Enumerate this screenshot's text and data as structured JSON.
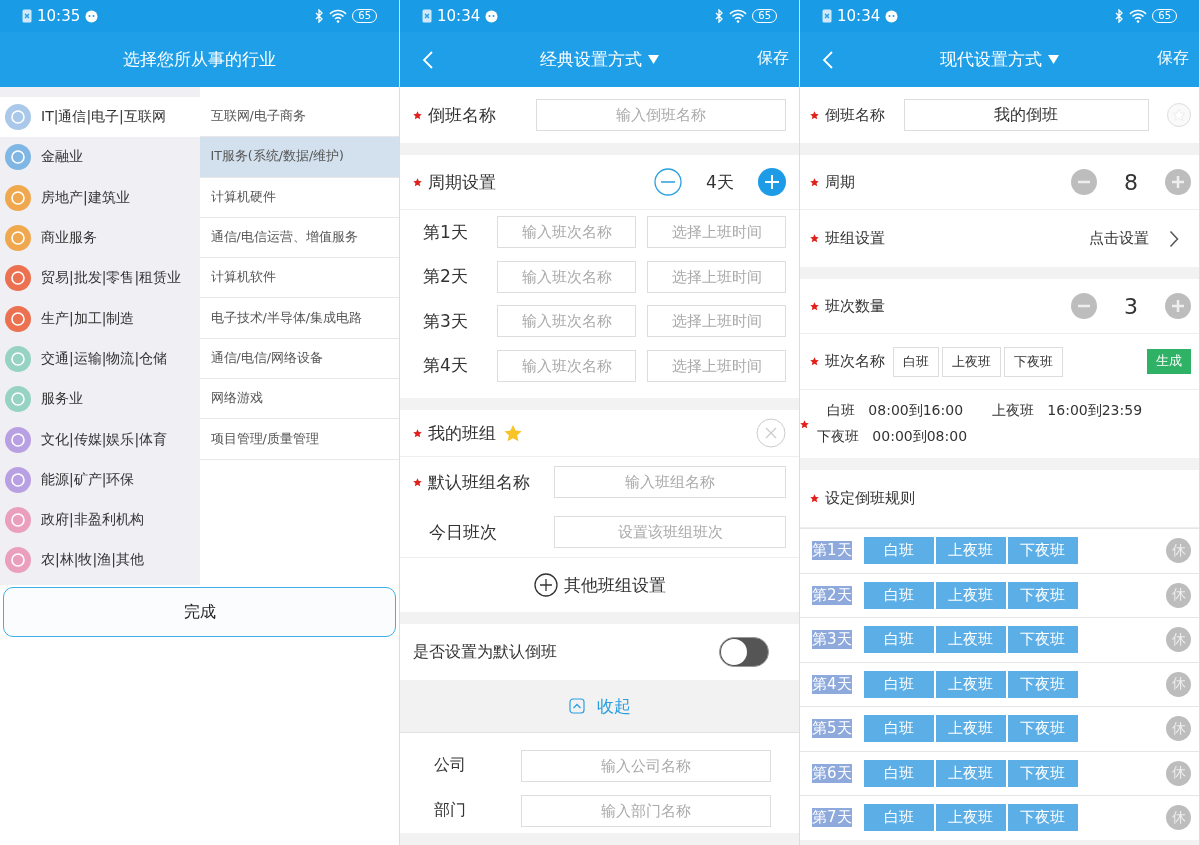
{
  "industry_screen": {
    "status_bar": {
      "time": "10:35",
      "battery": "65"
    },
    "title": "选择您所从事的行业",
    "industries": [
      {
        "label": "IT|通信|电子|互联网",
        "color": "#a9c8ea",
        "selected": true
      },
      {
        "label": "金融业",
        "color": "#7fb6e3",
        "selected": false
      },
      {
        "label": "房地产|建筑业",
        "color": "#f0a84e",
        "selected": false
      },
      {
        "label": "商业服务",
        "color": "#f0a84e",
        "selected": false
      },
      {
        "label": "贸易|批发|零售|租赁业",
        "color": "#ec7150",
        "selected": false
      },
      {
        "label": "生产|加工|制造",
        "color": "#ec7150",
        "selected": false
      },
      {
        "label": "交通|运输|物流|仓储",
        "color": "#96d3c2",
        "selected": false
      },
      {
        "label": "服务业",
        "color": "#96d3c2",
        "selected": false
      },
      {
        "label": "文化|传媒|娱乐|体育",
        "color": "#b9a0e3",
        "selected": false
      },
      {
        "label": "能源|矿产|环保",
        "color": "#b9a0e3",
        "selected": false
      },
      {
        "label": "政府|非盈利机构",
        "color": "#eaa0bd",
        "selected": false
      },
      {
        "label": "农|林|牧|渔|其他",
        "color": "#eaa0bd",
        "selected": false
      }
    ],
    "subcategories": [
      {
        "label": "互联网/电子商务",
        "selected": false
      },
      {
        "label": "IT服务(系统/数据/维护)",
        "selected": true
      },
      {
        "label": "计算机硬件",
        "selected": false
      },
      {
        "label": "通信/电信运营、增值服务",
        "selected": false
      },
      {
        "label": "计算机软件",
        "selected": false
      },
      {
        "label": "电子技术/半导体/集成电路",
        "selected": false
      },
      {
        "label": "通信/电信/网络设备",
        "selected": false
      },
      {
        "label": "网络游戏",
        "selected": false
      },
      {
        "label": "项目管理/质量管理",
        "selected": false
      }
    ],
    "done_button": "完成"
  },
  "classic_screen": {
    "status_bar": {
      "time": "10:34",
      "battery": "65"
    },
    "title": "经典设置方式",
    "save": "保存",
    "name_label": "倒班名称",
    "name_placeholder": "输入倒班名称",
    "period_label": "周期设置",
    "period_value": "4天",
    "days": [
      {
        "label": "第1天",
        "shift_placeholder": "输入班次名称",
        "time_placeholder": "选择上班时间"
      },
      {
        "label": "第2天",
        "shift_placeholder": "输入班次名称",
        "time_placeholder": "选择上班时间"
      },
      {
        "label": "第3天",
        "shift_placeholder": "输入班次名称",
        "time_placeholder": "选择上班时间"
      },
      {
        "label": "第4天",
        "shift_placeholder": "输入班次名称",
        "time_placeholder": "选择上班时间"
      }
    ],
    "group_title": "我的班组",
    "group_fields": [
      {
        "label": "默认班组名称",
        "required": true,
        "placeholder": "输入班组名称"
      },
      {
        "label": "今日班次",
        "required": false,
        "placeholder": "设置该班组班次"
      }
    ],
    "other_groups": "其他班组设置",
    "default_toggle": {
      "label": "是否设置为默认倒班",
      "on": false
    },
    "collapse": "收起",
    "org_fields": [
      {
        "label": "公司",
        "placeholder": "输入公司名称"
      },
      {
        "label": "部门",
        "placeholder": "输入部门名称"
      }
    ]
  },
  "modern_screen": {
    "status_bar": {
      "time": "10:34",
      "battery": "65"
    },
    "title": "现代设置方式",
    "save": "保存",
    "name_label": "倒班名称",
    "name_value": "我的倒班",
    "period_label": "周期",
    "period_value": "8",
    "group_label": "班组设置",
    "group_action": "点击设置",
    "count_label": "班次数量",
    "count_value": "3",
    "shift_names_label": "班次名称",
    "shift_names": [
      "白班",
      "上夜班",
      "下夜班"
    ],
    "generate": "生成",
    "shift_times": [
      {
        "name": "白班",
        "time": "08:00到16:00"
      },
      {
        "name": "上夜班",
        "time": "16:00到23:59"
      },
      {
        "name": "下夜班",
        "time": "00:00到08:00"
      }
    ],
    "rules_label": "设定倒班规则",
    "rule_days": [
      {
        "label": "第1天",
        "shifts": [
          "白班",
          "上夜班",
          "下夜班"
        ],
        "rest": "休"
      },
      {
        "label": "第2天",
        "shifts": [
          "白班",
          "上夜班",
          "下夜班"
        ],
        "rest": "休"
      },
      {
        "label": "第3天",
        "shifts": [
          "白班",
          "上夜班",
          "下夜班"
        ],
        "rest": "休"
      },
      {
        "label": "第4天",
        "shifts": [
          "白班",
          "上夜班",
          "下夜班"
        ],
        "rest": "休"
      },
      {
        "label": "第5天",
        "shifts": [
          "白班",
          "上夜班",
          "下夜班"
        ],
        "rest": "休"
      },
      {
        "label": "第6天",
        "shifts": [
          "白班",
          "上夜班",
          "下夜班"
        ],
        "rest": "休"
      },
      {
        "label": "第7天",
        "shifts": [
          "白班",
          "上夜班",
          "下夜班"
        ],
        "rest": "休"
      }
    ]
  }
}
